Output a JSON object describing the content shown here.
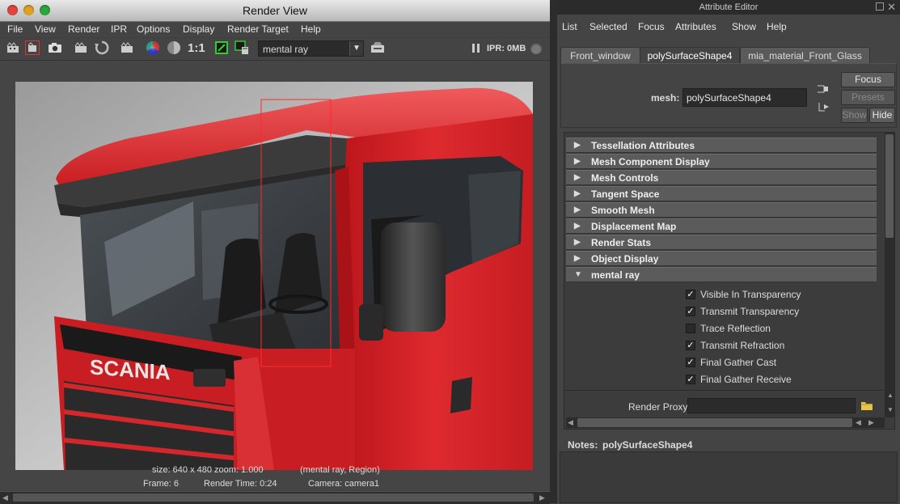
{
  "render_view": {
    "title": "Render View",
    "menu": [
      "File",
      "View",
      "Render",
      "IPR",
      "Options",
      "Display",
      "Render Target",
      "Help"
    ],
    "toolbar": {
      "one_to_one": "1:1",
      "renderer": "mental ray",
      "ipr_status": "IPR: 0MB"
    },
    "image": {
      "logo_text": "SCANIA"
    },
    "info_line1": "size: 640 x 480 zoom: 1.000",
    "info_line1_mode": "(mental ray, Region)",
    "frame": "Frame: 6",
    "render_time": "Render Time: 0:24",
    "camera": "Camera: camera1"
  },
  "attribute_editor": {
    "title": "Attribute Editor",
    "menu": [
      "List",
      "Selected",
      "Focus",
      "Attributes",
      "Show",
      "Help"
    ],
    "tabs": [
      "Front_window",
      "polySurfaceShape4",
      "mia_material_Front_Glass"
    ],
    "active_tab": 1,
    "mesh_label": "mesh:",
    "mesh_value": "polySurfaceShape4",
    "buttons": {
      "focus": "Focus",
      "presets": "Presets",
      "show": "Show",
      "hide": "Hide"
    },
    "sections": [
      "Tessellation Attributes",
      "Mesh Component Display",
      "Mesh Controls",
      "Tangent Space",
      "Smooth Mesh",
      "Displacement Map",
      "Render Stats",
      "Object Display",
      "mental ray"
    ],
    "checkboxes": [
      {
        "label": "Visible In Transparency",
        "checked": true
      },
      {
        "label": "Transmit Transparency",
        "checked": true
      },
      {
        "label": "Trace Reflection",
        "checked": false
      },
      {
        "label": "Transmit Refraction",
        "checked": true
      },
      {
        "label": "Final Gather Cast",
        "checked": true
      },
      {
        "label": "Final Gather Receive",
        "checked": true
      }
    ],
    "render_proxy_label": "Render Proxy",
    "render_proxy_value": "",
    "notes_label": "Notes:",
    "notes_value": "polySurfaceShape4"
  },
  "colors": {
    "truck_red": "#d8282c",
    "panel_bg": "#444444",
    "region_outline": "#ff2a2a"
  }
}
